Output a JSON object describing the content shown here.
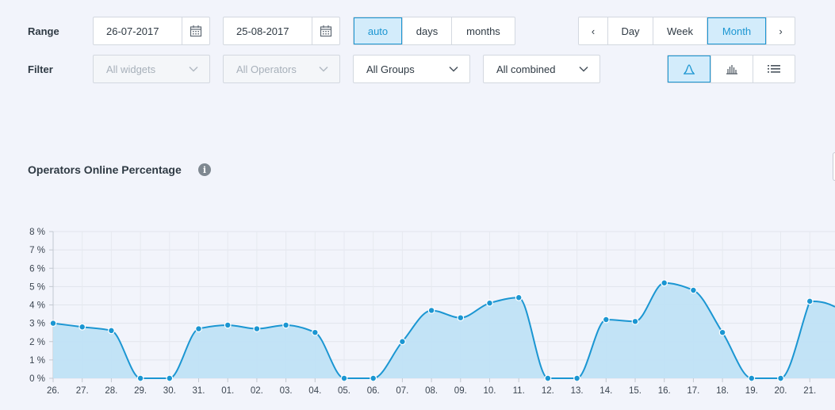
{
  "filters": {
    "range_label": "Range",
    "filter_label": "Filter",
    "date_from": "26-07-2017",
    "date_to": "25-08-2017",
    "granularity": [
      "auto",
      "days",
      "months"
    ],
    "granularity_selected": "auto",
    "period_prev": "‹",
    "period_next": "›",
    "periods": [
      "Day",
      "Week",
      "Month"
    ],
    "period_selected": "Month",
    "widgets": "All widgets",
    "operators": "All Operators",
    "groups": "All Groups",
    "combined": "All combined",
    "views": [
      "line-chart-icon",
      "bar-chart-icon",
      "list-icon"
    ],
    "view_selected": "line-chart-icon"
  },
  "section": {
    "title": "Operators Online Percentage",
    "info": "i"
  },
  "colors": {
    "accent": "#1b96d2",
    "area": "#bfe2f5",
    "active_bg": "#d3ecfb"
  },
  "chart_data": {
    "type": "area",
    "title": "Operators Online Percentage",
    "xlabel": "",
    "ylabel": "",
    "ylim": [
      0,
      8
    ],
    "y_ticks": [
      "0 %",
      "1 %",
      "2 %",
      "3 %",
      "4 %",
      "5 %",
      "6 %",
      "7 %",
      "8 %"
    ],
    "grid": true,
    "categories": [
      "26.",
      "27.",
      "28.",
      "29.",
      "30.",
      "31.",
      "01.",
      "02.",
      "03.",
      "04.",
      "05.",
      "06.",
      "07.",
      "08.",
      "09.",
      "10.",
      "11.",
      "12.",
      "13.",
      "14.",
      "15.",
      "16.",
      "17.",
      "18.",
      "19.",
      "20.",
      "21."
    ],
    "series": [
      {
        "values": [
          3.0,
          2.8,
          2.6,
          0,
          0,
          2.7,
          2.9,
          2.7,
          2.9,
          2.5,
          0,
          0,
          2.0,
          3.7,
          3.3,
          4.1,
          4.4,
          0,
          0,
          3.2,
          3.1,
          5.2,
          4.8,
          2.5,
          0,
          0,
          4.2
        ]
      }
    ]
  }
}
